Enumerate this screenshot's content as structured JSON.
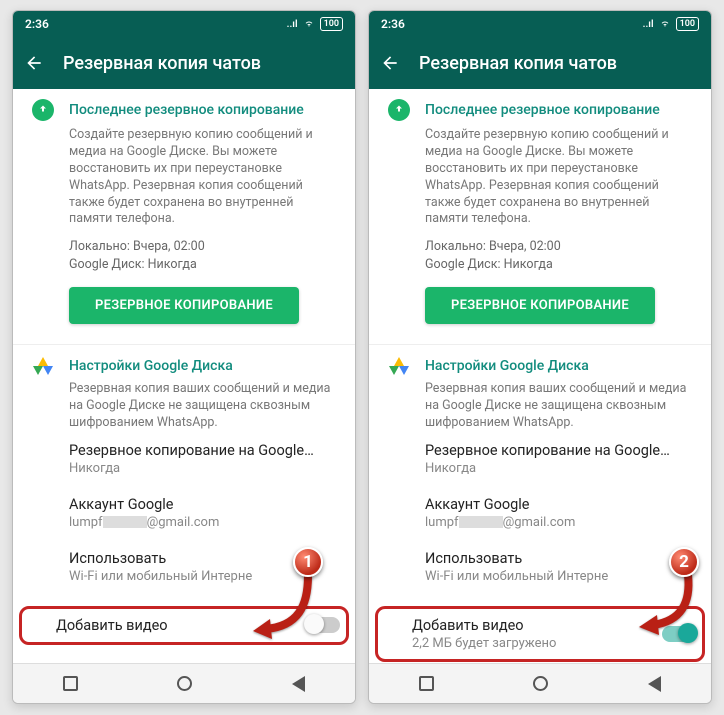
{
  "statusbar": {
    "time": "2:36",
    "battery": "100"
  },
  "appbar": {
    "title": "Резервная копия чатов"
  },
  "backup_section": {
    "title": "Последнее резервное копирование",
    "description": "Создайте резервную копию сообщений и медиа на Google Диске. Вы можете восстановить их при переустановке WhatsApp. Резервная копия сообщений также будет сохранена во внутренней памяти телефона.",
    "local_label": "Локально: Вчера, 02:00",
    "gdrive_label": "Google Диск: Никогда",
    "button": "РЕЗЕРВНОЕ КОПИРОВАНИЕ"
  },
  "drive_section": {
    "title": "Настройки Google Диска",
    "description": "Резервная копия ваших сообщений и медиа на Google Диске не защищена сквозным шифрованием WhatsApp.",
    "rows": {
      "backup_to": {
        "title": "Резервное копирование на Google…",
        "sub": "Никогда"
      },
      "account": {
        "title": "Аккаунт Google",
        "sub_prefix": "lumpf",
        "sub_suffix": "@gmail.com"
      },
      "network": {
        "title": "Использовать",
        "sub": "Wi-Fi или мобильный Интерне"
      },
      "include_video_off": {
        "title": "Добавить видео"
      },
      "include_video_on": {
        "title": "Добавить видео",
        "sub": "2,2 МБ будет загружено"
      }
    }
  },
  "callouts": {
    "one": "1",
    "two": "2"
  }
}
